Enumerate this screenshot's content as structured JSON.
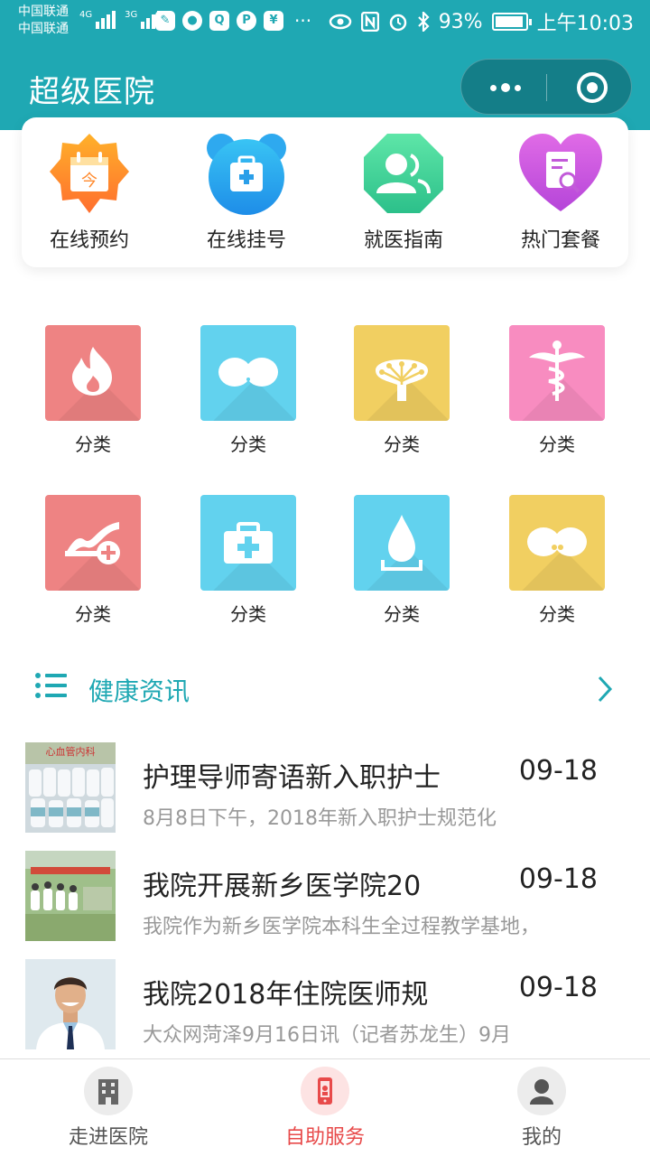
{
  "colors": {
    "brand": "#1fa8b3",
    "tab_active": "#e84a4a",
    "muted": "#999999"
  },
  "status_bar": {
    "carrier_line1": "中国联通",
    "carrier_line2": "中国联通",
    "net_tag_1": "4G",
    "net_tag_2": "3G",
    "battery": "93%",
    "time": "上午10:03"
  },
  "app": {
    "title": "超级医院"
  },
  "quick_actions": [
    {
      "label": "在线预约",
      "icon": "calendar-icon"
    },
    {
      "label": "在线挂号",
      "icon": "medical-kit-icon"
    },
    {
      "label": "就医指南",
      "icon": "people-icon"
    },
    {
      "label": "热门套餐",
      "icon": "document-search-icon"
    }
  ],
  "categories": [
    {
      "label": "分类",
      "icon": "flame-icon",
      "color": "#ee8383"
    },
    {
      "label": "分类",
      "icon": "lungs-icon",
      "color": "#62d2ee"
    },
    {
      "label": "分类",
      "icon": "tree-icon",
      "color": "#f1cf61"
    },
    {
      "label": "分类",
      "icon": "caduceus-icon",
      "color": "#f88cc0"
    },
    {
      "label": "分类",
      "icon": "pulse-plus-icon",
      "color": "#ee8383"
    },
    {
      "label": "分类",
      "icon": "first-aid-kit-icon",
      "color": "#62d2ee"
    },
    {
      "label": "分类",
      "icon": "water-drop-icon",
      "color": "#62d2ee"
    },
    {
      "label": "分类",
      "icon": "kidneys-icon",
      "color": "#f1cf61"
    }
  ],
  "news_section": {
    "title": "健康资讯"
  },
  "news": [
    {
      "headline": "护理导师寄语新入职护士",
      "date": "09-18",
      "summary": "8月8日下午，2018年新入职护士规范化"
    },
    {
      "headline": "我院开展新乡医学院20",
      "date": "09-18",
      "summary": "我院作为新乡医学院本科生全过程教学基地，"
    },
    {
      "headline": "我院2018年住院医师规",
      "date": "09-18",
      "summary": "大众网菏泽9月16日讯（记者苏龙生）9月"
    }
  ],
  "tabs": [
    {
      "label": "走进医院",
      "icon": "hospital-icon",
      "active": false
    },
    {
      "label": "自助服务",
      "icon": "phone-icon",
      "active": true
    },
    {
      "label": "我的",
      "icon": "user-icon",
      "active": false
    }
  ]
}
